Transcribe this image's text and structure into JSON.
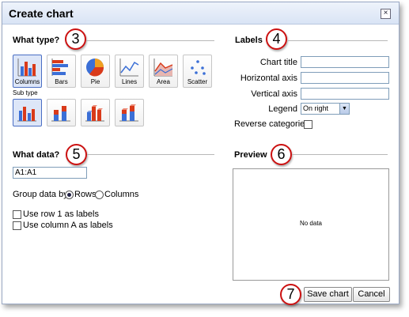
{
  "dialog": {
    "title": "Create chart",
    "close_glyph": "×"
  },
  "what_type": {
    "heading": "What type?",
    "callout": "3",
    "types": [
      {
        "label": "Columns",
        "icon": "columns-chart-icon",
        "selected": true
      },
      {
        "label": "Bars",
        "icon": "bars-chart-icon",
        "selected": false
      },
      {
        "label": "Pie",
        "icon": "pie-chart-icon",
        "selected": false
      },
      {
        "label": "Lines",
        "icon": "lines-chart-icon",
        "selected": false
      },
      {
        "label": "Area",
        "icon": "area-chart-icon",
        "selected": false
      },
      {
        "label": "Scatter",
        "icon": "scatter-chart-icon",
        "selected": false
      }
    ],
    "subtype_label": "Sub type",
    "subtypes": [
      {
        "icon": "clustered-columns-icon",
        "selected": true
      },
      {
        "icon": "stacked-columns-icon",
        "selected": false
      },
      {
        "icon": "3d-columns-icon",
        "selected": false
      },
      {
        "icon": "3d-stacked-columns-icon",
        "selected": false
      }
    ]
  },
  "labels": {
    "heading": "Labels",
    "callout": "4",
    "chart_title_label": "Chart title",
    "chart_title_value": "",
    "horizontal_axis_label": "Horizontal axis",
    "horizontal_axis_value": "",
    "vertical_axis_label": "Vertical axis",
    "vertical_axis_value": "",
    "legend_label": "Legend",
    "legend_value": "On right",
    "reverse_label": "Reverse categories",
    "reverse_checked": false
  },
  "what_data": {
    "heading": "What data?",
    "callout": "5",
    "range_value": "A1:A1",
    "group_by_label": "Group data by",
    "group_by_options": [
      "Rows",
      "Columns"
    ],
    "group_by_selected": "Rows",
    "use_row1_label": "Use row 1 as labels",
    "use_row1_checked": false,
    "use_colA_label": "Use column A as labels",
    "use_colA_checked": false
  },
  "preview": {
    "heading": "Preview",
    "callout": "6",
    "empty_text": "No data"
  },
  "footer": {
    "callout": "7",
    "save_label": "Save chart",
    "cancel_label": "Cancel"
  },
  "colors": {
    "accent_blue": "#3b6fd6",
    "accent_red": "#d93a1a",
    "accent_orange": "#f0a020",
    "callout_red": "#cc1111"
  }
}
